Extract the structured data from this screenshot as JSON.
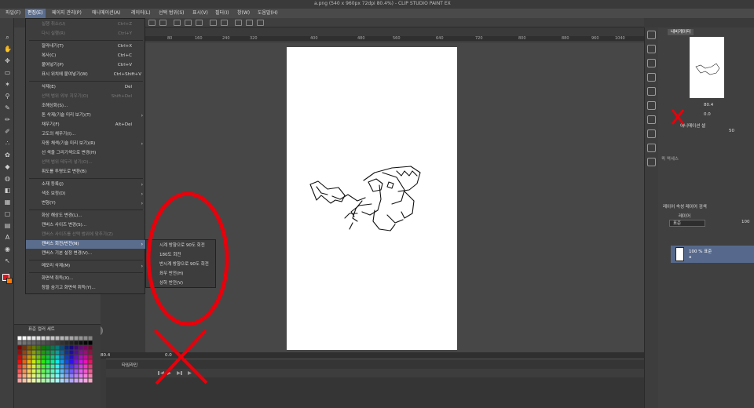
{
  "window": {
    "title": "a.png (540 x 960px 72dpi 80.4%) - CLIP STUDIO PAINT EX"
  },
  "menubar": [
    {
      "label": "파일(F)"
    },
    {
      "label": "편집(E)"
    },
    {
      "label": "페이지 관리(P)"
    },
    {
      "label": "애니메이션(A)"
    },
    {
      "label": "레이어(L)"
    },
    {
      "label": "선택 범위(S)"
    },
    {
      "label": "표시(V)"
    },
    {
      "label": "필터(I)"
    },
    {
      "label": "창(W)"
    },
    {
      "label": "도움말(H)"
    }
  ],
  "edit_menu": [
    {
      "label": "실행 취소(U)",
      "shortcut": "Ctrl+Z",
      "disabled": true
    },
    {
      "label": "다시 실행(R)",
      "shortcut": "Ctrl+Y",
      "disabled": true
    },
    {
      "label": "잘라내기(T)",
      "shortcut": "Ctrl+X"
    },
    {
      "label": "복사(C)",
      "shortcut": "Ctrl+C"
    },
    {
      "label": "붙여넣기(P)",
      "shortcut": "Ctrl+V"
    },
    {
      "label": "표시 위치에 붙여넣기(W)",
      "shortcut": "Ctrl+Shift+V"
    },
    {
      "label": "삭제(E)",
      "shortcut": "Del"
    },
    {
      "label": "선택 범위 외부 지우기(O)",
      "shortcut": "Shift+Del",
      "disabled": true
    },
    {
      "label": "조해상화(S)..."
    },
    {
      "label": "톤 삭제(기술 미리 보기)(T)",
      "submenu": true
    },
    {
      "label": "채우기(F)",
      "shortcut": "Alt+Del"
    },
    {
      "label": "고도의 채우기(I)..."
    },
    {
      "label": "자동 채색(기술 미리 보기)(R)",
      "submenu": true
    },
    {
      "label": "선 색을 그리기색으로 변경(H)"
    },
    {
      "label": "선택 범위 테두리 넣기(O)...",
      "disabled": true
    },
    {
      "label": "휘도를 투명도로 변환(B)"
    },
    {
      "label": "소재 등록(J)",
      "submenu": true
    },
    {
      "label": "색조 보정(D)",
      "submenu": true
    },
    {
      "label": "변형(Y)",
      "submenu": true
    },
    {
      "label": "화상 해상도 변경(L)..."
    },
    {
      "label": "캔버스 사이즈 변경(S)..."
    },
    {
      "label": "캔버스 사이즈를 선택 범위에 맞추기(Z)",
      "disabled": true
    },
    {
      "label": "캔버스 회전/반전(N)",
      "submenu": true,
      "highlighted": true
    },
    {
      "label": "캔버스 기본 설정 변경(V)..."
    },
    {
      "label": "메모리 삭제(M)",
      "submenu": true
    },
    {
      "label": "화면색 취득(X)..."
    },
    {
      "label": "창을 숨기고 화면색 취득(Y)..."
    }
  ],
  "sub_menu": [
    {
      "label": "시계 방향으로 90도 회전"
    },
    {
      "label": "180도 회전"
    },
    {
      "label": "반시계 방향으로 90도 회전"
    },
    {
      "label": "좌우 반전(H)"
    },
    {
      "label": "상하 반전(V)"
    }
  ],
  "ruler": [
    "80",
    "160",
    "240",
    "320",
    "400",
    "480",
    "560",
    "640",
    "720",
    "800",
    "880",
    "960",
    "1040"
  ],
  "palette": {
    "title": "표준 컬러 세트"
  },
  "status": {
    "zoom": "80.4",
    "angle": "0.0"
  },
  "timeline": {
    "tab": "타임라인"
  },
  "navigator": {
    "tab": "내비게이터",
    "zoom": "80.4",
    "angle": "0.0"
  },
  "anim_panel": {
    "tab": "애니메이션 셀",
    "value": "50"
  },
  "reference_panel": {
    "tab": "퀵 액세스"
  },
  "layer_panel": {
    "tabs": "레이어 속성  레이어 검색",
    "tab2": "레이어",
    "blend": "표준",
    "opacity": "100",
    "layer_name": "100 % 표준",
    "layer_sub": "a"
  },
  "colors": {
    "accent": "#5b6d8d",
    "main_color": "#e0141c",
    "sub_color": "#ff7800",
    "annotation": "#e8000a"
  }
}
